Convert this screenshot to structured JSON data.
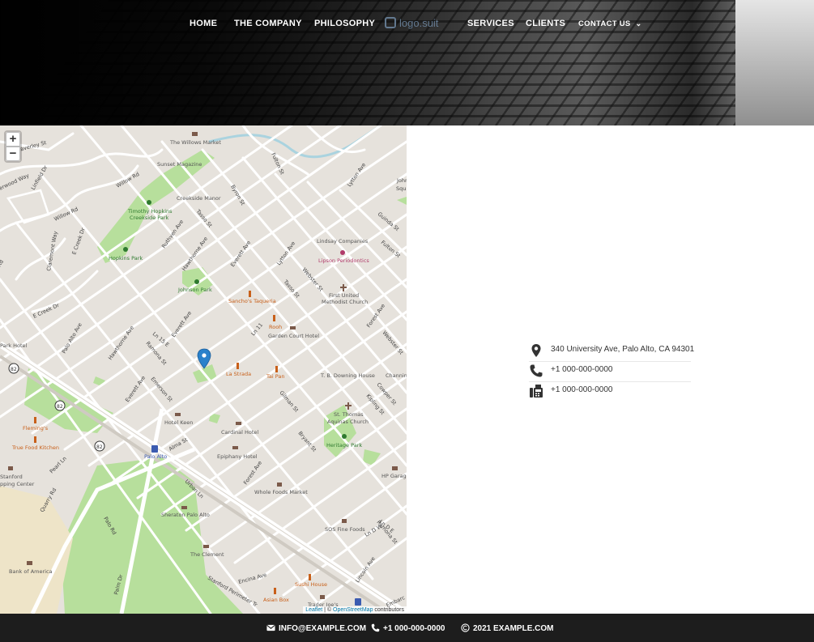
{
  "nav": {
    "items": [
      {
        "label": "HOME"
      },
      {
        "label": "THE COMPANY"
      },
      {
        "label": "PHILOSOPHY"
      },
      {
        "label": "SERVICES"
      },
      {
        "label": "CLIENTS"
      },
      {
        "label": "CONTACT US"
      }
    ],
    "logo_text": "logo.suit",
    "contact_caret_icon": "chevron-down-icon"
  },
  "map": {
    "zoom_in": "+",
    "zoom_out": "−",
    "attribution": {
      "leaflet": "Leaflet",
      "separator": " | © ",
      "osm": "OpenStreetMap",
      "suffix": " contributors"
    },
    "labels": {
      "willows_market": "The Willows Market",
      "sunset_magazine": "Sunset Magazine",
      "creekside_manor": "Creekside Manor",
      "timothy_hopkins": "Timothy Hopkins",
      "creekside_park": "Creekside Park",
      "hopkins_park": "Hopkins Park",
      "johnson_park": "Johnson Park",
      "lindsay": "Lindsay Companies",
      "lipson": "Lipson Periodontics",
      "first_united": "First United",
      "methodist": "Methodist Church",
      "sanchos": "Sancho's Taqueria",
      "rooh": "Rooh",
      "garden_court": "Garden Court Hotel",
      "la_strada": "La Strada",
      "tai_pan": "Tai Pan",
      "downing": "T. B. Downing House",
      "channing": "Channin",
      "park_hotel": "Park Hotel",
      "hotel_keen": "Hotel Keen",
      "cardinal": "Cardinal Hotel",
      "epiphany": "Epiphany Hotel",
      "palo_alto": "Palo Alto",
      "st_thomas": "St. Thomas",
      "aquinas": "Aquinas Church",
      "heritage_park": "Heritage Park",
      "hp_garage": "HP Garage",
      "whole_foods": "Whole Foods Market",
      "sos_fine": "SOS Fine Foods",
      "sheraton": "Sheraton Palo Alto",
      "the_clement": "The Clement",
      "sushi_house": "Sushi House",
      "asian_box": "Asian Box",
      "bank_america": "Bank of America",
      "flemings": "Fleming's",
      "true_food": "True Food Kitchen",
      "stanford": "Stanford",
      "shopping": "pping Center",
      "traders": "Trader Joe's",
      "s_82a": "82",
      "s_82b": "82",
      "s_82c": "82"
    },
    "streets": {
      "waverley": "Waverley St",
      "willow1": "Willow Rd",
      "willow2": "Willow Rd",
      "linfield": "Linfield Dr",
      "erwood": "erwood Way",
      "ecreek1": "E Creek Dr",
      "ecreek2": "E Creek Dr",
      "claremont": "Claremont Way",
      "rd": "Rd",
      "byron": "Byron St",
      "tasso1": "Tasso St",
      "tasso2": "Tasso St",
      "ruthven": "Ruthven Ave",
      "hawthorne1": "Hawthorne Ave",
      "hawthorne2": "Hawthorne Ave",
      "everett1": "Everett Ave",
      "everett2": "Everett Ave",
      "everett3": "Everett Ave",
      "lytton1": "Lytton Ave",
      "lytton2": "Lytton Ave",
      "fulton1": "Fulton St",
      "fulton2": "Fulton St",
      "guinda": "Guinda St",
      "webster1": "Webster St",
      "webster2": "Webster St",
      "forest1": "Forest Ave",
      "forest2": "Forest Ave",
      "kipling": "Kipling St",
      "cowper": "Cowper St",
      "gilman": "Gilman St",
      "bryant": "Bryant St",
      "ramona1": "Ramona St",
      "ramona2": "Ramona St",
      "emerson": "Emerson St",
      "alma": "Alma St",
      "urban": "Urban Ln",
      "ln_te": "Ln 15 E",
      "ln_tw": "Ln 11",
      "ln_de": "Ln D E",
      "ln_dw": "Ln D W",
      "palo_alto_ave": "Palo Alto Ave",
      "pearl": "Pearl Ln",
      "quarry": "Quarry Rd",
      "palo_rd": "Palo Rd",
      "palm": "Palm Dr",
      "encina": "Encina Ave",
      "lincoln": "Lincoln Ave",
      "embarc": "Embarc",
      "stanford_perimeter": "Stanford Perimeter Tr",
      "john": "John",
      "squ": "Squ"
    }
  },
  "contact": {
    "address": "340 University Ave, Palo Alto, CA 94301",
    "phone": "+1 000-000-0000",
    "fax": "+1 000-000-0000",
    "icons": [
      "map-pin-icon",
      "phone-icon",
      "fax-icon"
    ]
  },
  "footer": {
    "email": "INFO@EXAMPLE.COM",
    "phone": "+1 000-000-0000",
    "copyright": "2021 EXAMPLE.COM"
  }
}
